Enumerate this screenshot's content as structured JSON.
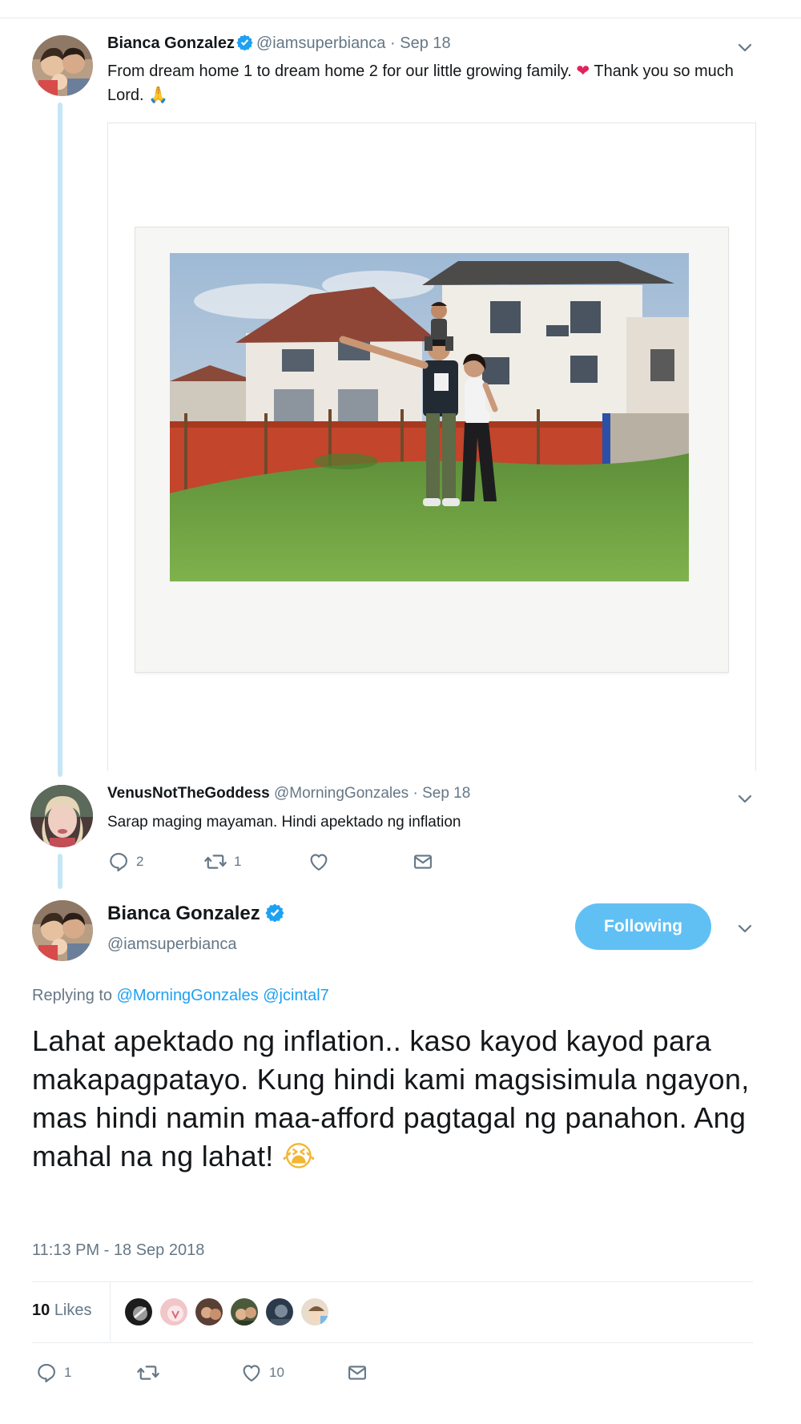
{
  "tweet1": {
    "name": "Bianca Gonzalez",
    "handle": "@iamsuperbianca",
    "separator": "·",
    "date": "Sep 18",
    "text_part1": "From dream home 1 to dream home 2 for our little growing family.",
    "heart_emoji": "❤",
    "text_part2": "Thank you so much Lord.",
    "pray_emoji": "🙏"
  },
  "tweet2": {
    "name": "VenusNotTheGoddess",
    "handle": "@MorningGonzales",
    "separator": "·",
    "date": "Sep 18",
    "text": "Sarap maging mayaman. Hindi apektado ng inflation",
    "reply_count": "2",
    "retweet_count": "1"
  },
  "tweet3": {
    "name": "Bianca Gonzalez",
    "handle": "@iamsuperbianca",
    "follow_label": "Following",
    "replying_prefix": "Replying to",
    "replying_to_1": "@MorningGonzales",
    "replying_to_2": "@jcintal7",
    "text": "Lahat apektado ng inflation.. kaso kayod kayod para makapagpatayo. Kung hindi kami magsisimula ngayon, mas hindi namin maa-afford pagtagal ng panahon. Ang mahal na ng lahat!",
    "cry_emoji": "😭",
    "timestamp": "11:13 PM - 18 Sep 2018",
    "likes_count": "10",
    "likes_label": "Likes",
    "reply_count": "1",
    "like_count": "10"
  },
  "icons": {
    "verified": "verified-badge-icon",
    "chevron": "chevron-down-icon",
    "reply": "reply-icon",
    "retweet": "retweet-icon",
    "like": "heart-icon",
    "dm": "envelope-icon"
  },
  "colors": {
    "accent": "#1da1f2",
    "follow_button": "#60c0f4",
    "thread_line": "#c4e6f5",
    "muted_text": "#657786"
  }
}
